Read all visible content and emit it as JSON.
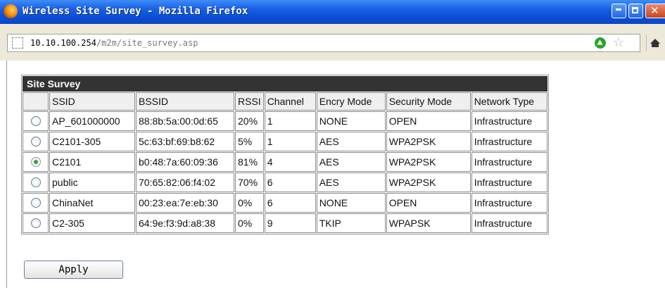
{
  "window": {
    "title": "Wireless Site Survey - Mozilla Firefox",
    "controls": {
      "minimize_icon": "minimize-icon",
      "maximize_icon": "maximize-icon",
      "close_icon": "close-icon"
    }
  },
  "address_bar": {
    "url_host": "10.10.100.254",
    "url_path": "/m2m/site_survey.asp"
  },
  "site_survey": {
    "caption": "Site Survey",
    "columns": [
      "",
      "SSID",
      "BSSID",
      "RSSI",
      "Channel",
      "Encry Mode",
      "Security Mode",
      "Network Type"
    ],
    "rows": [
      {
        "selected": false,
        "ssid": "AP_601000000",
        "bssid": "88:8b:5a:00:0d:65",
        "rssi": "20%",
        "channel": "1",
        "encry": "NONE",
        "security": "OPEN",
        "network": "Infrastructure"
      },
      {
        "selected": false,
        "ssid": "C2101-305",
        "bssid": "5c:63:bf:69:b8:62",
        "rssi": "5%",
        "channel": "1",
        "encry": "AES",
        "security": "WPA2PSK",
        "network": "Infrastructure"
      },
      {
        "selected": true,
        "ssid": "C2101",
        "bssid": "b0:48:7a:60:09:36",
        "rssi": "81%",
        "channel": "4",
        "encry": "AES",
        "security": "WPA2PSK",
        "network": "Infrastructure"
      },
      {
        "selected": false,
        "ssid": "public",
        "bssid": "70:65:82:06:f4:02",
        "rssi": "70%",
        "channel": "6",
        "encry": "AES",
        "security": "WPA2PSK",
        "network": "Infrastructure"
      },
      {
        "selected": false,
        "ssid": "ChinaNet",
        "bssid": "00:23:ea:7e:eb:30",
        "rssi": "0%",
        "channel": "6",
        "encry": "NONE",
        "security": "OPEN",
        "network": "Infrastructure"
      },
      {
        "selected": false,
        "ssid": "C2-305",
        "bssid": "64:9e:f3:9d:a8:38",
        "rssi": "0%",
        "channel": "9",
        "encry": "TKIP",
        "security": "WPAPSK",
        "network": "Infrastructure"
      }
    ]
  },
  "apply_label": "Apply",
  "colors": {
    "titlebar": "#0a4fd8",
    "table_header": "#333333",
    "radio_selected": "#2da62d"
  }
}
